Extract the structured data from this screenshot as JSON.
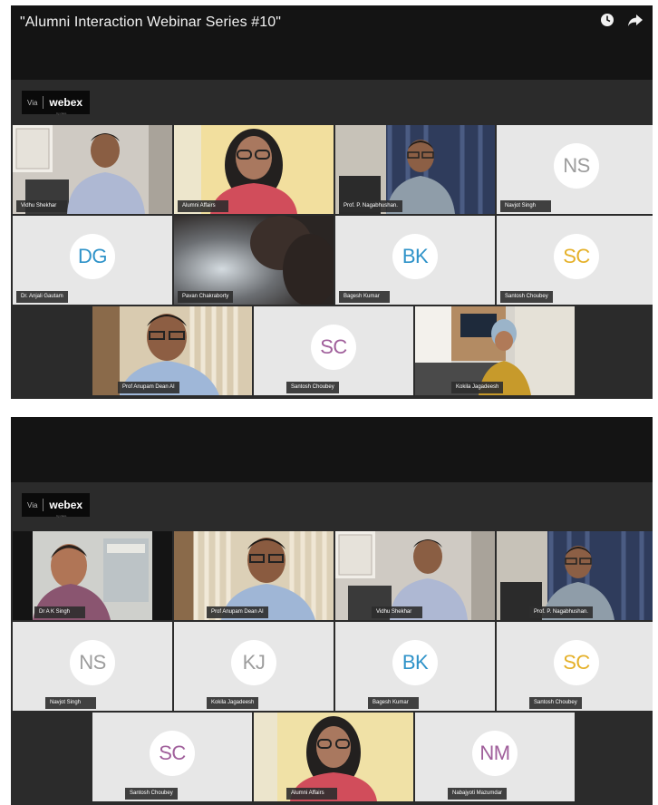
{
  "shots": [
    {
      "title": "\"Alumni Interaction Webinar Series #10\"",
      "branding": {
        "via": "Via",
        "brand": "webex",
        "sub": "by cisco"
      },
      "icons": [
        "clock-icon",
        "share-arrow-icon"
      ],
      "tiles": [
        {
          "name": "Vidhu Shekhar",
          "kind": "video"
        },
        {
          "name": "Alumni Affairs",
          "kind": "video"
        },
        {
          "name": "Prof. P. Nagabhushan.",
          "kind": "video"
        },
        {
          "name": "Navjot Singh",
          "kind": "avatar",
          "initials": "NS",
          "color": "#9d9d9d"
        },
        {
          "name": "Dr. Anjali Gautam",
          "kind": "avatar",
          "initials": "DG",
          "color": "#2f93c9"
        },
        {
          "name": "Pavan Chakraborty",
          "kind": "video"
        },
        {
          "name": "Bagesh Kumar",
          "kind": "avatar",
          "initials": "BK",
          "color": "#2f93c9"
        },
        {
          "name": "Santosh Choubey",
          "kind": "avatar",
          "initials": "SC",
          "color": "#e5b12a"
        },
        {
          "name": "Prof Anupam Dean AI",
          "kind": "video"
        },
        {
          "name": "Santosh Choubey",
          "kind": "avatar",
          "initials": "SC",
          "color": "#a05f9b"
        },
        {
          "name": "Kokila Jagadeesh",
          "kind": "video"
        }
      ]
    },
    {
      "branding": {
        "via": "Via",
        "brand": "webex",
        "sub": "by cisco"
      },
      "tiles": [
        {
          "name": "Dr A K Singh",
          "kind": "video"
        },
        {
          "name": "Prof Anupam Dean AI",
          "kind": "video"
        },
        {
          "name": "Vidhu Shekhar",
          "kind": "video"
        },
        {
          "name": "Prof. P. Nagabhushan.",
          "kind": "video"
        },
        {
          "name": "Navjot Singh",
          "kind": "avatar",
          "initials": "NS",
          "color": "#9d9d9d"
        },
        {
          "name": "Kokila Jagadeesh",
          "kind": "avatar",
          "initials": "KJ",
          "color": "#9d9d9d"
        },
        {
          "name": "Bagesh Kumar",
          "kind": "avatar",
          "initials": "BK",
          "color": "#2f93c9"
        },
        {
          "name": "Santosh Choubey",
          "kind": "avatar",
          "initials": "SC",
          "color": "#e5b12a"
        },
        {
          "name": "Santosh Choubey",
          "kind": "avatar",
          "initials": "SC",
          "color": "#a05f9b"
        },
        {
          "name": "Alumni Affairs",
          "kind": "video"
        },
        {
          "name": "Nabajyoti Mazumdar",
          "kind": "avatar",
          "initials": "NM",
          "color": "#a05f9b"
        }
      ]
    }
  ]
}
